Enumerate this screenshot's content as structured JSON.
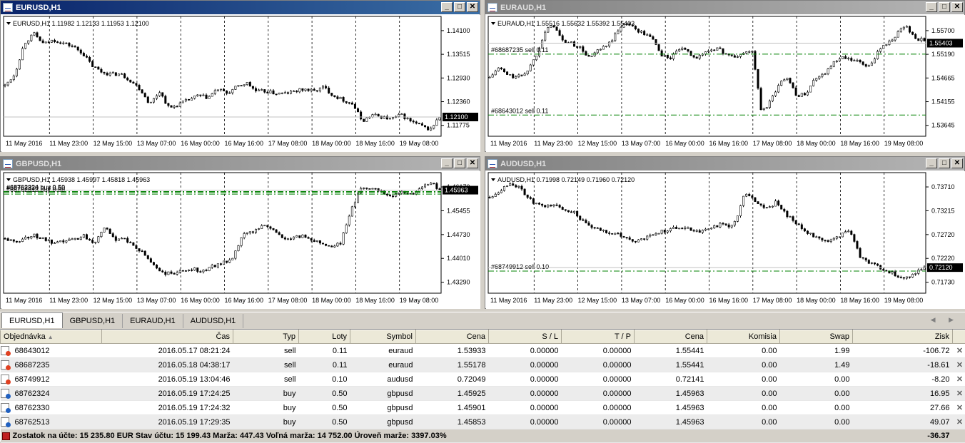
{
  "windows": [
    {
      "id": "eurusd",
      "title": "EURUSD,H1",
      "active": true,
      "info": "EURUSD,H1  1.11982 1.12133 1.11953 1.12100",
      "price_labels": [
        "1.14100",
        "1.13515",
        "1.12930",
        "1.12360",
        "1.11775"
      ],
      "current_price": "1.12100",
      "time_labels": [
        "11 May 2016",
        "11 May 23:00",
        "12 May 15:00",
        "13 May 07:00",
        "16 May 00:00",
        "16 May 16:00",
        "17 May 08:00",
        "18 May 00:00",
        "18 May 16:00",
        "19 May 08:00"
      ],
      "levels": [],
      "ymin": 1.1165,
      "ymax": 1.1445,
      "last": 1.121,
      "anchors": [
        1.1283,
        1.131,
        1.1383,
        1.1404,
        1.138,
        1.139,
        1.1383,
        1.1375,
        1.136,
        1.133,
        1.1315,
        1.131,
        1.131,
        1.1295,
        1.1275,
        1.124,
        1.127,
        1.123,
        1.124,
        1.125,
        1.126,
        1.1255,
        1.1275,
        1.1265,
        1.128,
        1.129,
        1.127,
        1.127,
        1.1265,
        1.1265,
        1.127,
        1.1275,
        1.127,
        1.128,
        1.126,
        1.125,
        1.124,
        1.12,
        1.1215,
        1.121,
        1.1205,
        1.1215,
        1.12,
        1.119,
        1.118,
        1.121
      ]
    },
    {
      "id": "euraud",
      "title": "EURAUD,H1",
      "active": false,
      "info": "EURAUD,H1  1.55516 1.55632 1.55392 1.55403",
      "price_labels": [
        "1.55700",
        "1.55190",
        "1.54665",
        "1.54155",
        "1.53645"
      ],
      "current_price": "1.55403",
      "time_labels": [
        "11 May 2016",
        "11 May 23:00",
        "12 May 15:00",
        "13 May 07:00",
        "16 May 00:00",
        "16 May 16:00",
        "17 May 08:00",
        "18 May 00:00",
        "18 May 16:00",
        "19 May 08:00"
      ],
      "levels": [
        {
          "label": "#68687235 sell 0.11",
          "price": 1.55178
        },
        {
          "label": "#68643012 sell 0.11",
          "price": 1.53933
        }
      ],
      "ymin": 1.535,
      "ymax": 1.5595,
      "last": 1.55403,
      "anchors": [
        1.547,
        1.549,
        1.5475,
        1.547,
        1.548,
        1.551,
        1.556,
        1.558,
        1.5545,
        1.554,
        1.553,
        1.551,
        1.5525,
        1.5535,
        1.556,
        1.5585,
        1.557,
        1.556,
        1.555,
        1.5515,
        1.551,
        1.553,
        1.552,
        1.551,
        1.5525,
        1.553,
        1.552,
        1.551,
        1.552,
        1.5525,
        1.54,
        1.542,
        1.546,
        1.547,
        1.543,
        1.544,
        1.547,
        1.548,
        1.55,
        1.551,
        1.5505,
        1.55,
        1.549,
        1.553,
        1.554,
        1.556,
        1.5575,
        1.555,
        1.5545
      ]
    },
    {
      "id": "gbpusd",
      "title": "GBPUSD,H1",
      "active": false,
      "info": "GBPUSD,H1  1.45938 1.45997 1.45818 1.45963",
      "price_labels": [
        "1.46170",
        "1.45455",
        "1.44730",
        "1.44010",
        "1.43290"
      ],
      "current_price": "1.45963",
      "time_labels": [
        "11 May 2016",
        "11 May 23:00",
        "12 May 15:00",
        "13 May 07:00",
        "16 May 00:00",
        "16 May 16:00",
        "17 May 08:00",
        "18 May 00:00",
        "18 May 16:00",
        "19 May 08:00"
      ],
      "levels": [
        {
          "label": "#68762324 buy 0.50",
          "price": 1.45925
        },
        {
          "label": "#68762330 buy 0.50",
          "price": 1.45901
        },
        {
          "label": "#68762513 buy 0.50",
          "price": 1.45853
        }
      ],
      "ymin": 1.431,
      "ymax": 1.4645,
      "last": 1.45963,
      "anchors": [
        1.4462,
        1.445,
        1.4465,
        1.447,
        1.446,
        1.4445,
        1.4455,
        1.446,
        1.447,
        1.445,
        1.4495,
        1.446,
        1.4465,
        1.444,
        1.442,
        1.439,
        1.4365,
        1.4365,
        1.437,
        1.438,
        1.437,
        1.4385,
        1.4395,
        1.44,
        1.447,
        1.448,
        1.45,
        1.449,
        1.4465,
        1.446,
        1.447,
        1.446,
        1.445,
        1.444,
        1.445,
        1.454,
        1.46,
        1.4605,
        1.4595,
        1.458,
        1.459,
        1.4585,
        1.46,
        1.462,
        1.4596
      ]
    },
    {
      "id": "audusd",
      "title": "AUDUSD,H1",
      "active": false,
      "info": "AUDUSD,H1  0.71998 0.72149 0.71960 0.72120",
      "price_labels": [
        "0.73710",
        "0.73215",
        "0.72720",
        "0.72220",
        "0.71730"
      ],
      "current_price": "0.72120",
      "time_labels": [
        "11 May 2016",
        "11 May 23:00",
        "12 May 15:00",
        "13 May 07:00",
        "16 May 00:00",
        "16 May 16:00",
        "17 May 08:00",
        "18 May 00:00",
        "18 May 16:00",
        "19 May 08:00"
      ],
      "levels": [
        {
          "label": "#68749912 sell 0.10",
          "price": 0.72049
        }
      ],
      "ymin": 0.716,
      "ymax": 0.7405,
      "last": 0.7212,
      "anchors": [
        0.7355,
        0.737,
        0.7385,
        0.737,
        0.7345,
        0.7335,
        0.734,
        0.733,
        0.7325,
        0.73,
        0.729,
        0.7285,
        0.728,
        0.727,
        0.7265,
        0.7275,
        0.7285,
        0.729,
        0.7295,
        0.729,
        0.7285,
        0.7295,
        0.73,
        0.7295,
        0.736,
        0.735,
        0.733,
        0.7345,
        0.732,
        0.73,
        0.728,
        0.7275,
        0.7265,
        0.7275,
        0.729,
        0.723,
        0.722,
        0.721,
        0.72,
        0.719,
        0.72,
        0.7212
      ]
    }
  ],
  "tabs": [
    "EURUSD,H1",
    "GBPUSD,H1",
    "EURAUD,H1",
    "AUDUSD,H1"
  ],
  "tab_arrows": "◀ ▶",
  "table": {
    "headers": [
      "Objednávka",
      "Čas",
      "Typ",
      "Loty",
      "Symbol",
      "Cena",
      "S / L",
      "T / P",
      "Cena",
      "Komisia",
      "Swap",
      "Zisk"
    ],
    "sort_arrow": "▲",
    "rows": [
      {
        "order": "68643012",
        "time": "2016.05.17 08:21:24",
        "type": "sell",
        "lots": "0.11",
        "symbol": "euraud",
        "price": "1.53933",
        "sl": "0.00000",
        "tp": "0.00000",
        "cur": "1.55441",
        "comm": "0.00",
        "swap": "1.99",
        "profit": "-106.72"
      },
      {
        "order": "68687235",
        "time": "2016.05.18 04:38:17",
        "type": "sell",
        "lots": "0.11",
        "symbol": "euraud",
        "price": "1.55178",
        "sl": "0.00000",
        "tp": "0.00000",
        "cur": "1.55441",
        "comm": "0.00",
        "swap": "1.49",
        "profit": "-18.61"
      },
      {
        "order": "68749912",
        "time": "2016.05.19 13:04:46",
        "type": "sell",
        "lots": "0.10",
        "symbol": "audusd",
        "price": "0.72049",
        "sl": "0.00000",
        "tp": "0.00000",
        "cur": "0.72141",
        "comm": "0.00",
        "swap": "0.00",
        "profit": "-8.20"
      },
      {
        "order": "68762324",
        "time": "2016.05.19 17:24:25",
        "type": "buy",
        "lots": "0.50",
        "symbol": "gbpusd",
        "price": "1.45925",
        "sl": "0.00000",
        "tp": "0.00000",
        "cur": "1.45963",
        "comm": "0.00",
        "swap": "0.00",
        "profit": "16.95"
      },
      {
        "order": "68762330",
        "time": "2016.05.19 17:24:32",
        "type": "buy",
        "lots": "0.50",
        "symbol": "gbpusd",
        "price": "1.45901",
        "sl": "0.00000",
        "tp": "0.00000",
        "cur": "1.45963",
        "comm": "0.00",
        "swap": "0.00",
        "profit": "27.66"
      },
      {
        "order": "68762513",
        "time": "2016.05.19 17:29:35",
        "type": "buy",
        "lots": "0.50",
        "symbol": "gbpusd",
        "price": "1.45853",
        "sl": "0.00000",
        "tp": "0.00000",
        "cur": "1.45963",
        "comm": "0.00",
        "swap": "0.00",
        "profit": "49.07"
      }
    ],
    "close_glyph": "✕",
    "summary": "Zostatok na účte: 15 235.80 EUR  Stav účtu: 15 199.43  Marža: 447.43  Voľná marža: 14 752.00  Úroveň marže: 3397.03%",
    "summary_profit": "-36.37"
  },
  "window_buttons": [
    "_",
    "□",
    "✕"
  ]
}
